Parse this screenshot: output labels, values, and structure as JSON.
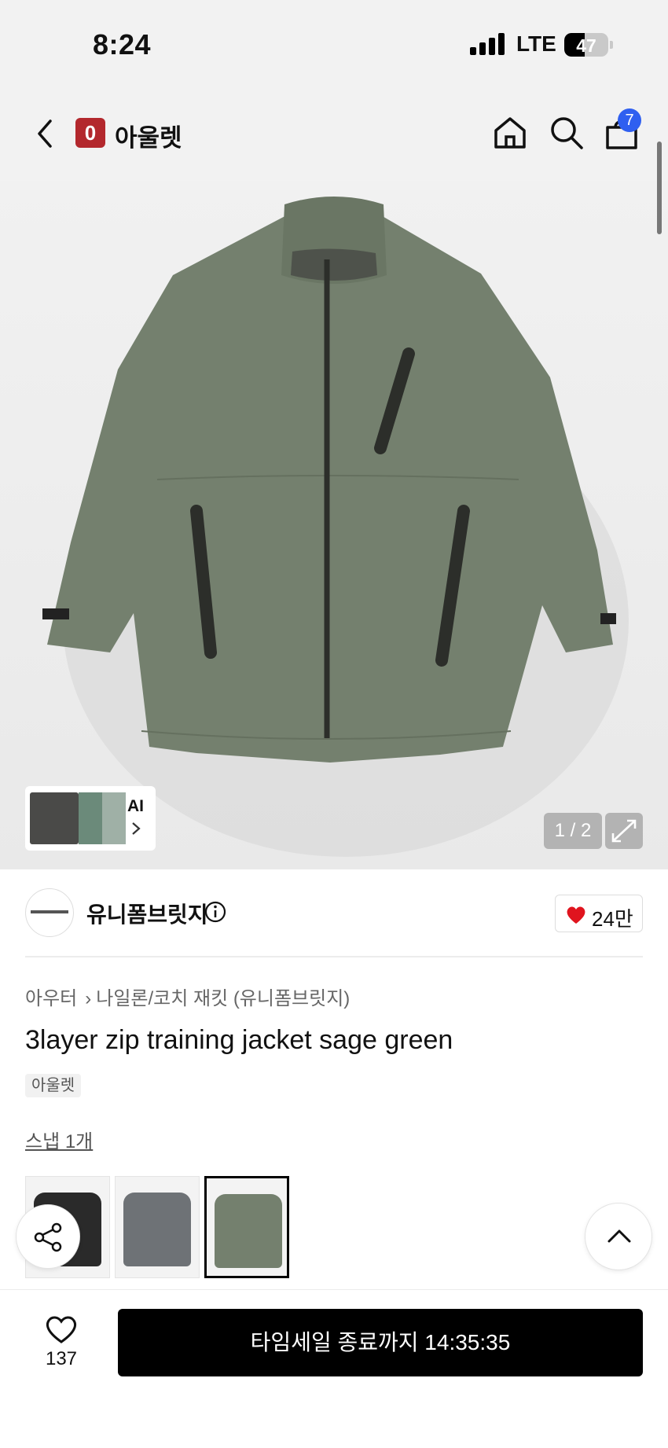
{
  "status_bar": {
    "time": "8:24",
    "network": "LTE",
    "battery": "47",
    "battery_level": 0.47
  },
  "nav": {
    "logo_letter": "0",
    "logo_text": "아울렛",
    "icons": [
      "back-icon",
      "home-icon",
      "search-icon",
      "bag-icon"
    ],
    "cart_count": "7",
    "brand_color": "#b3282d",
    "badge_color": "#2f5ff0"
  },
  "hero": {
    "image": "sage green zip training jacket",
    "ai_label": "AI",
    "page_indicator": "1 / 2"
  },
  "brand": {
    "name": "유니폼브릿지",
    "likes": "24만"
  },
  "product": {
    "category": "아우터",
    "subcategory": "나일론/코치 재킷 (유니폼브릿지)",
    "title": "3layer zip training jacket sage green",
    "tag": "아울렛",
    "snap": "스냅 1개"
  },
  "swatches": [
    {
      "name": "black",
      "color": "#2a2a2a"
    },
    {
      "name": "gray",
      "color": "#6e7276"
    },
    {
      "name": "sage green",
      "color": "#74806e",
      "selected": true
    }
  ],
  "bottom": {
    "wish_count": "137",
    "cta_label": "타임세일 종료까지 14:35:35"
  }
}
